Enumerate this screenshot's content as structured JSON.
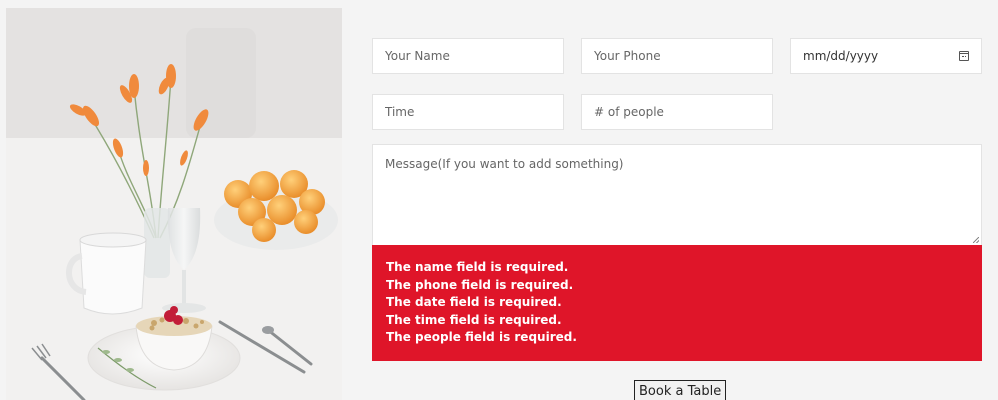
{
  "form": {
    "name_placeholder": "Your Name",
    "phone_placeholder": "Your Phone",
    "date_placeholder": "mm/dd/yyyy",
    "time_placeholder": "Time",
    "people_placeholder": "# of people",
    "message_placeholder": "Message(If you want to add something)",
    "date_icon": "calendar-icon",
    "submit_label": "Book a Table"
  },
  "errors": [
    "The name field is required.",
    "The phone field is required.",
    "The date field is required.",
    "The time field is required.",
    "The people field is required."
  ],
  "colors": {
    "error_background": "#df1529",
    "page_background": "#f4f4f4"
  }
}
